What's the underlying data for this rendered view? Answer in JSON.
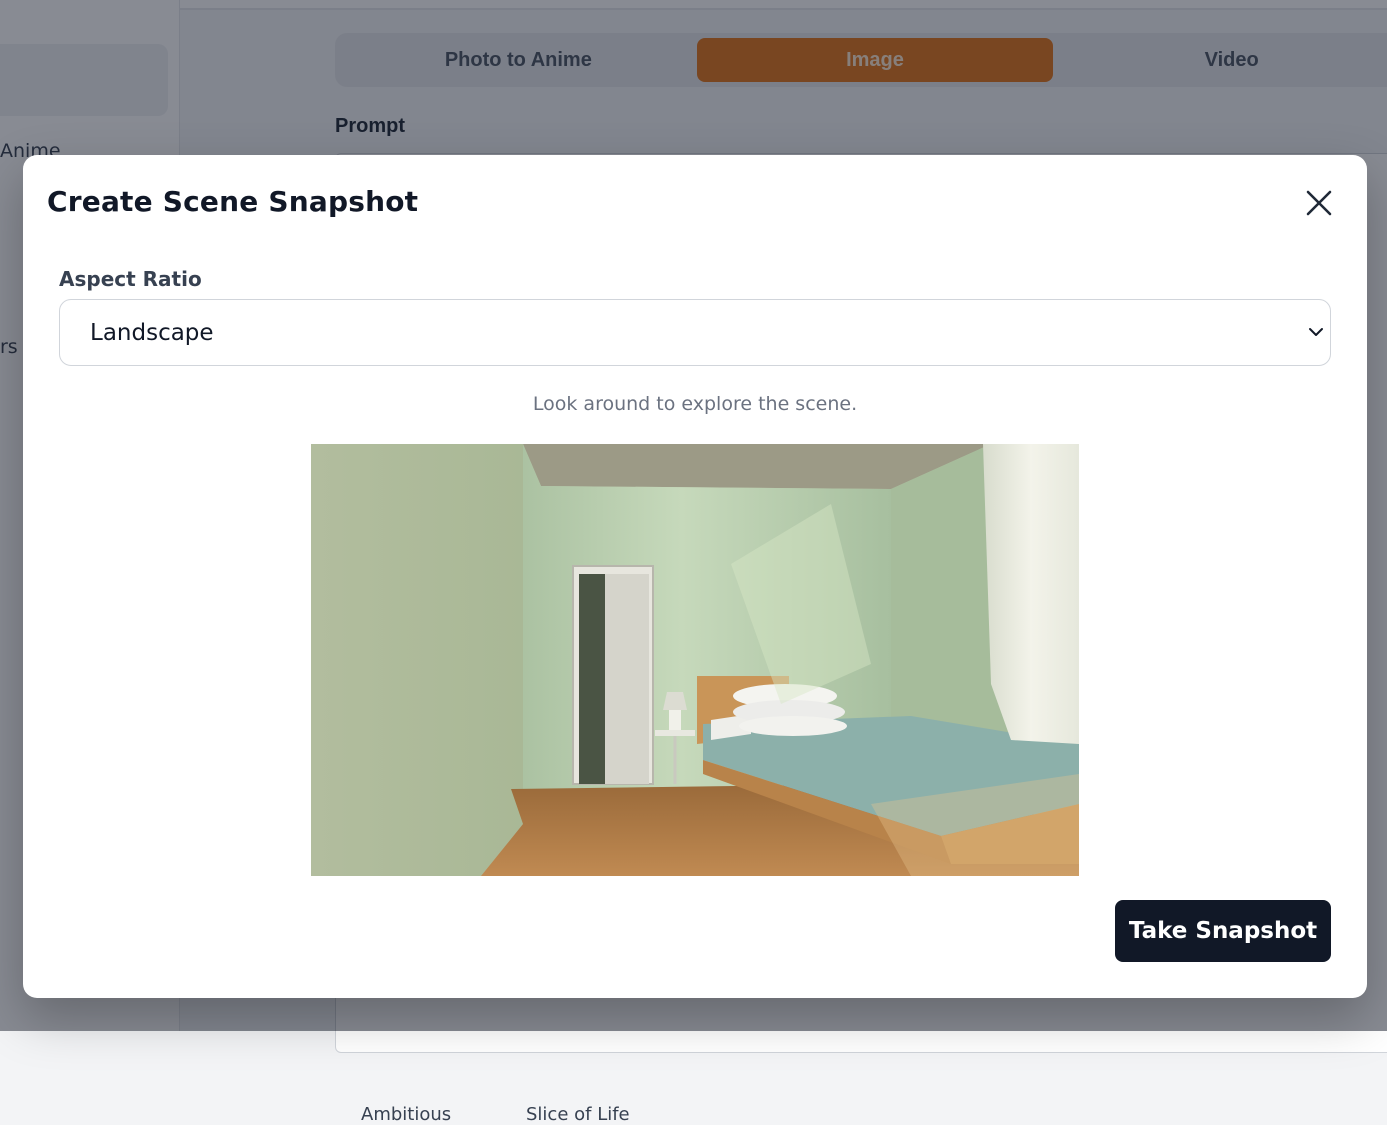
{
  "sidebar": {
    "item_anime_partial": "Anime",
    "item_partial_2": "rs"
  },
  "tabs": [
    {
      "label": "Photo to Anime",
      "active": false
    },
    {
      "label": "Image",
      "active": true
    },
    {
      "label": "Video",
      "active": false
    }
  ],
  "prompt_label": "Prompt",
  "background_bottom": {
    "left_text": "Ambitious",
    "right_text": "Slice of Life"
  },
  "colors": {
    "accent": "#e0751a",
    "primary_button": "#111827"
  },
  "modal": {
    "title": "Create Scene Snapshot",
    "close_icon": "close-icon",
    "aspect_ratio_label": "Aspect Ratio",
    "aspect_ratio_value": "Landscape",
    "hint": "Look around to explore the scene.",
    "scene_description_icon": "bedroom-3d-view",
    "snapshot_button": "Take Snapshot"
  }
}
